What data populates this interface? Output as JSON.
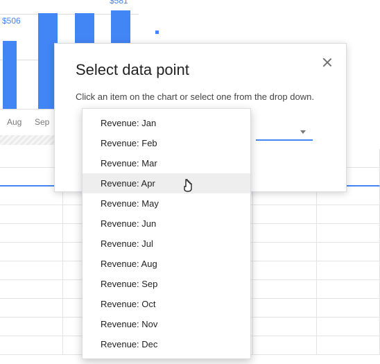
{
  "chart_data": {
    "type": "bar",
    "categories": [
      "Aug",
      "Sep"
    ],
    "values": [
      506,
      581
    ],
    "title": "",
    "xlabel": "",
    "ylabel": "",
    "ylim": [
      0,
      800
    ]
  },
  "chart": {
    "label_506": "$506",
    "label_581": "$581",
    "xlabels": {
      "aug": "Aug",
      "sep": "Sep"
    }
  },
  "modal": {
    "title": "Select data point",
    "description": "Click an item on the chart or select one from the drop down."
  },
  "dropdown": {
    "options": [
      "Revenue: Jan",
      "Revenue: Feb",
      "Revenue: Mar",
      "Revenue: Apr",
      "Revenue: May",
      "Revenue: Jun",
      "Revenue: Jul",
      "Revenue: Aug",
      "Revenue: Sep",
      "Revenue: Oct",
      "Revenue: Nov",
      "Revenue: Dec"
    ],
    "selected_index": 3
  }
}
